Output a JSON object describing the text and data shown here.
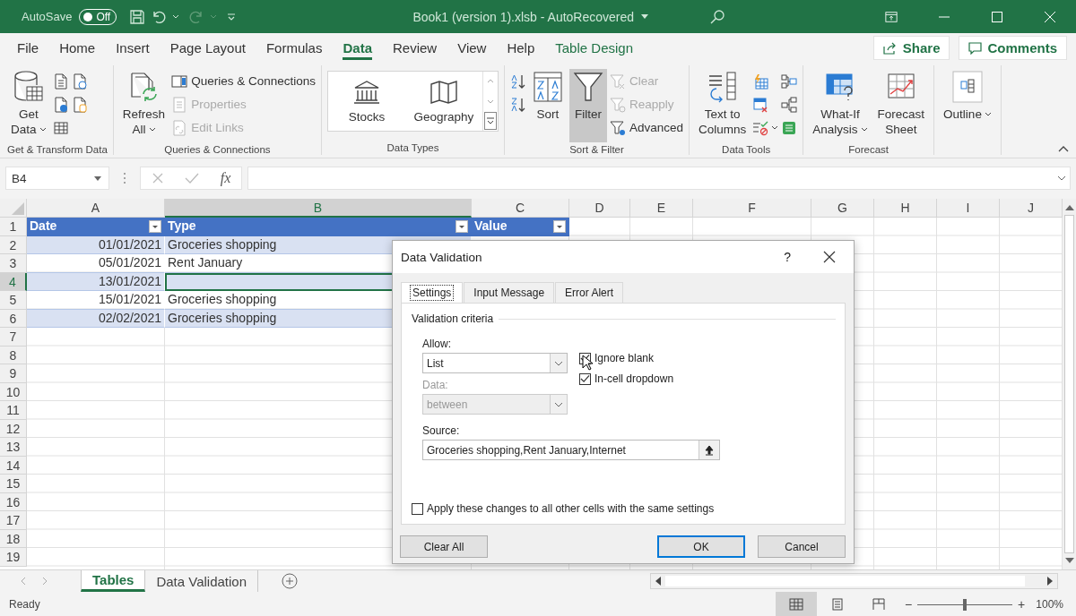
{
  "title_bar": {
    "autosave_label": "AutoSave",
    "autosave": {
      "on": false,
      "text": "Off"
    },
    "title": "Book1 (version 1).xlsb  -  AutoRecovered"
  },
  "menu_tabs": [
    {
      "label": "File",
      "selected": false,
      "kind": "normal"
    },
    {
      "label": "Home",
      "selected": false,
      "kind": "normal"
    },
    {
      "label": "Insert",
      "selected": false,
      "kind": "normal"
    },
    {
      "label": "Page Layout",
      "selected": false,
      "kind": "normal"
    },
    {
      "label": "Formulas",
      "selected": false,
      "kind": "normal"
    },
    {
      "label": "Data",
      "selected": true,
      "kind": "normal"
    },
    {
      "label": "Review",
      "selected": false,
      "kind": "normal"
    },
    {
      "label": "View",
      "selected": false,
      "kind": "normal"
    },
    {
      "label": "Help",
      "selected": false,
      "kind": "normal"
    },
    {
      "label": "Table Design",
      "selected": false,
      "kind": "contextual"
    }
  ],
  "share": "Share",
  "comments": "Comments",
  "ribbon": [
    {
      "label": "Get & Transform Data",
      "items": [
        {
          "kind": "large",
          "lines": [
            "Get",
            "Data"
          ],
          "menu": true,
          "on": false,
          "disabled": false
        },
        {
          "kind": "icon"
        },
        {
          "kind": "icon"
        },
        {
          "kind": "icon"
        },
        {
          "kind": "icon"
        },
        {
          "kind": "icon"
        }
      ]
    },
    {
      "label": "Queries & Connections",
      "items": [
        {
          "kind": "large",
          "lines": [
            "Refresh",
            "All"
          ],
          "menu": true,
          "on": false,
          "disabled": false
        },
        {
          "kind": "small",
          "label": "Queries & Connections",
          "disabled": false
        },
        {
          "kind": "small",
          "label": "Properties",
          "disabled": true
        },
        {
          "kind": "small",
          "label": "Edit Links",
          "disabled": true
        }
      ]
    },
    {
      "label": "Data Types",
      "items": [
        {
          "kind": "gallery",
          "tiles": [
            "Stocks",
            "Geography"
          ]
        }
      ]
    },
    {
      "label": "Sort & Filter",
      "items": [
        {
          "kind": "icon"
        },
        {
          "kind": "icon"
        },
        {
          "kind": "large",
          "lines": [
            "Sort"
          ],
          "menu": false,
          "on": false,
          "disabled": false
        },
        {
          "kind": "large",
          "lines": [
            "Filter"
          ],
          "menu": false,
          "on": true,
          "disabled": false
        },
        {
          "kind": "small",
          "label": "Clear",
          "disabled": true
        },
        {
          "kind": "small",
          "label": "Reapply",
          "disabled": true
        },
        {
          "kind": "small",
          "label": "Advanced",
          "disabled": false
        }
      ]
    },
    {
      "label": "Data Tools",
      "items": [
        {
          "kind": "large",
          "lines": [
            "Text to",
            "Columns"
          ],
          "menu": false,
          "on": false,
          "disabled": false
        },
        {
          "kind": "icon"
        },
        {
          "kind": "icon"
        },
        {
          "kind": "icon",
          "menu": true
        },
        {
          "kind": "icon"
        },
        {
          "kind": "icon"
        },
        {
          "kind": "icon"
        }
      ]
    },
    {
      "label": "Forecast",
      "items": [
        {
          "kind": "large",
          "lines": [
            "What-If",
            "Analysis"
          ],
          "menu": true,
          "on": false,
          "disabled": false
        },
        {
          "kind": "large",
          "lines": [
            "Forecast",
            "Sheet"
          ],
          "menu": false,
          "on": false,
          "disabled": false
        }
      ]
    },
    {
      "items": [
        {
          "kind": "large",
          "lines": [
            "Outline"
          ],
          "menu": true,
          "on": false,
          "disabled": false
        }
      ]
    }
  ],
  "formula_bar": {
    "name_box": "B4",
    "function_label": "fx"
  },
  "sheet": {
    "columns": [
      {
        "label": "A",
        "selected": false
      },
      {
        "label": "B",
        "selected": true
      },
      {
        "label": "C",
        "selected": false
      },
      {
        "label": "D",
        "selected": false
      },
      {
        "label": "E",
        "selected": false
      },
      {
        "label": "F",
        "selected": false
      },
      {
        "label": "G",
        "selected": false
      },
      {
        "label": "H",
        "selected": false
      },
      {
        "label": "I",
        "selected": false
      },
      {
        "label": "J",
        "selected": false
      }
    ],
    "rows": [
      {
        "label": "1",
        "selected": false,
        "kind": "header",
        "cells": [
          "Date",
          "Type",
          "Value"
        ]
      },
      {
        "label": "2",
        "selected": false,
        "kind": "data",
        "cells": [
          "01/01/2021",
          "Groceries shopping"
        ]
      },
      {
        "label": "3",
        "selected": false,
        "kind": "data",
        "cells": [
          "05/01/2021",
          "Rent January"
        ]
      },
      {
        "label": "4",
        "selected": true,
        "kind": "data",
        "cells": [
          "13/01/2021"
        ]
      },
      {
        "label": "5",
        "selected": false,
        "kind": "data",
        "cells": [
          "15/01/2021",
          "Groceries shopping"
        ]
      },
      {
        "label": "6",
        "selected": false,
        "kind": "data",
        "cells": [
          "02/02/2021",
          "Groceries shopping"
        ]
      },
      {
        "label": "7",
        "selected": false
      },
      {
        "label": "8",
        "selected": false
      },
      {
        "label": "9",
        "selected": false
      },
      {
        "label": "10",
        "selected": false
      },
      {
        "label": "11",
        "selected": false
      },
      {
        "label": "12",
        "selected": false
      },
      {
        "label": "13",
        "selected": false
      },
      {
        "label": "14",
        "selected": false
      },
      {
        "label": "15",
        "selected": false
      },
      {
        "label": "16",
        "selected": false
      },
      {
        "label": "17",
        "selected": false
      },
      {
        "label": "18",
        "selected": false
      },
      {
        "label": "19",
        "selected": false
      }
    ]
  },
  "sheet_tabs": [
    {
      "label": "Tables",
      "selected": true
    },
    {
      "label": "Data Validation",
      "selected": false
    }
  ],
  "status_bar": {
    "status": "Ready",
    "views": [
      {
        "selected": true
      },
      {
        "selected": false
      },
      {
        "selected": false
      }
    ],
    "zoom_out": "−",
    "zoom_in": "+",
    "zoom": {
      "level": 0.5
    },
    "zoom_text": "100%"
  },
  "dialog": {
    "title": "Data Validation",
    "help": "?",
    "tabs": [
      {
        "label": "Settings",
        "selected": true
      },
      {
        "label": "Input Message",
        "selected": false
      },
      {
        "label": "Error Alert",
        "selected": false
      }
    ],
    "section": "Validation criteria",
    "allow": {
      "label": "Allow:",
      "value": "List",
      "disabled": false
    },
    "data": {
      "label": "Data:",
      "value": "between",
      "disabled": true
    },
    "options": [
      {
        "label": "Ignore blank",
        "checked": true
      },
      {
        "label": "In-cell dropdown",
        "checked": true
      }
    ],
    "source": {
      "label": "Source:",
      "value": "Groceries shopping,Rent January,Internet"
    },
    "apply": {
      "label": "Apply these changes to all other cells with the same settings",
      "checked": false
    },
    "buttons": [
      {
        "label": "Clear All",
        "kind": "left"
      },
      {
        "label": "OK",
        "kind": "default"
      },
      {
        "label": "Cancel",
        "kind": "normal"
      }
    ]
  }
}
